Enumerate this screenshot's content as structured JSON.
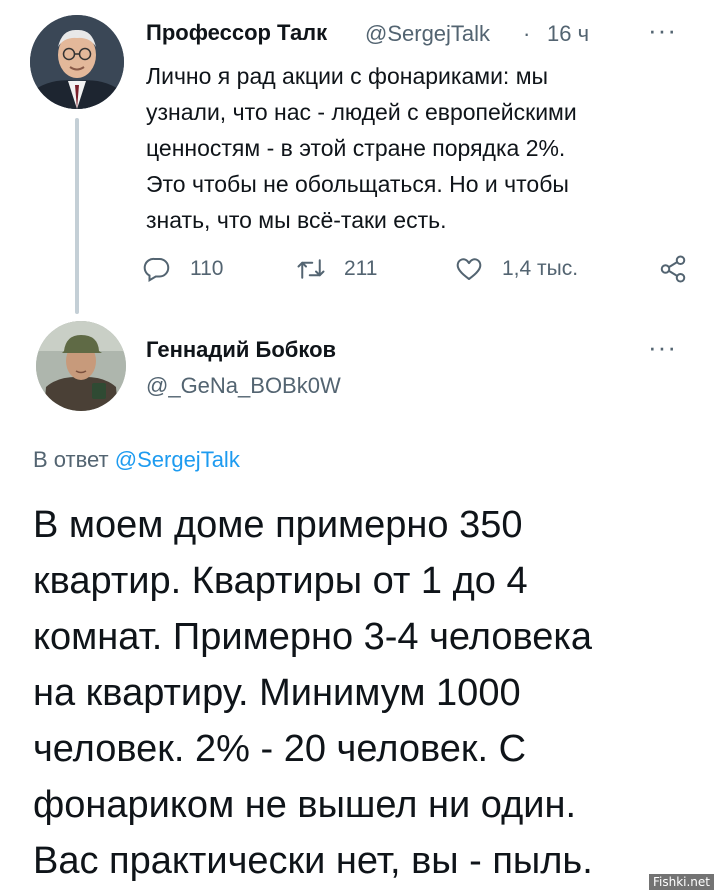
{
  "tweet1": {
    "author_name": "Профессор Талк",
    "handle": "@SergejTalk",
    "separator": "·",
    "time": "16 ч",
    "more": "···",
    "text": "Лично я рад акции с фонариками: мы\nузнали, что нас -  людей с европейскими\nценностям - в этой стране порядка 2%.\nЭто чтобы не обольщаться. Но и чтобы\nзнать, что мы всё-таки есть.",
    "replies": "110",
    "retweets": "211",
    "likes": "1,4 тыс."
  },
  "tweet2": {
    "author_name": "Геннадий Бобков",
    "handle": "@_GeNa_BOBk0W",
    "more": "···",
    "reply_to_prefix": "В ответ",
    "reply_to_mention": "@SergejTalk",
    "text": "В моем доме примерно 350\nквартир. Квартиры от 1 до 4\nкомнат. Примерно 3-4 человека\nна квартиру. Минимум 1000\nчеловек. 2% - 20 человек. С\nфонариком не вышел ни один.\nВас практически нет, вы - пыль."
  },
  "watermark": "Fishki.net",
  "icons": {
    "reply": "reply-icon",
    "retweet": "retweet-icon",
    "like": "heart-icon",
    "share": "share-icon"
  },
  "colors": {
    "text": "#0f1419",
    "muted": "#536471",
    "link": "#1d9bf0",
    "thread_line": "#c4cfd6"
  }
}
